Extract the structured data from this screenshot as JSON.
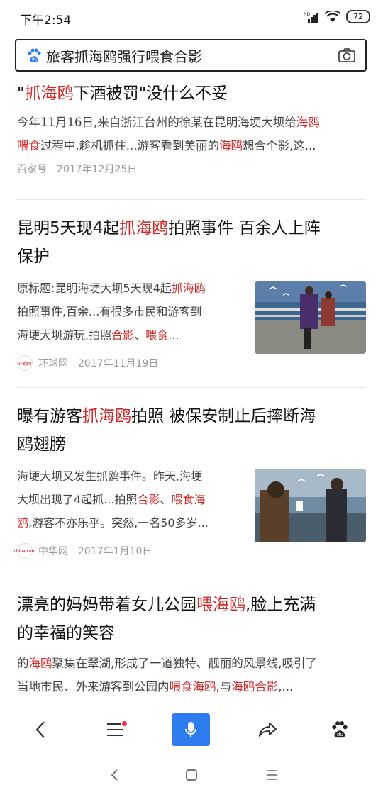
{
  "status": {
    "time": "下午2:54",
    "battery": "72"
  },
  "search": {
    "query": "旅客抓海鸥强行喂食合影"
  },
  "results": [
    {
      "title_parts": [
        "\"",
        "抓海鸥",
        "下酒被罚\"没什么不妥"
      ],
      "desc_line1": [
        "今年11月16日,来自浙江台州的徐某在昆明海埂大坝给",
        "海鸥"
      ],
      "desc_line2": [
        "喂食",
        "过程中,趁机抓住...游客看到美丽的",
        "海鸥",
        "想合个影,这..."
      ],
      "source": "百家号",
      "date": "2017年12月25日"
    },
    {
      "title_line1": [
        "昆明5天现4起",
        "抓海鸥",
        "拍照事件 百余人上阵"
      ],
      "title_line2": "保护",
      "desc_line1": [
        "原标题:昆明海埂大坝5天现4起",
        "抓海鸥"
      ],
      "desc_line2": "拍照事件,百余...有很多市民和游客到",
      "desc_line3": [
        "海埂大坝游玩,拍照",
        "合影",
        "、",
        "喂食",
        "..."
      ],
      "source_logo": "环球网",
      "source": "环球网",
      "date": "2017年11月19日"
    },
    {
      "title_line1": [
        "曝有游客",
        "抓海鸥",
        "拍照 被保安制止后摔断海"
      ],
      "title_line2": "鸥翅膀",
      "desc_line1": "海埂大坝又发生抓鸥事件。昨天,海埂",
      "desc_line2": [
        "大坝出现了4起抓...拍照",
        "合影",
        "、",
        "喂食海"
      ],
      "desc_line3": [
        "鸥",
        ",游客不亦乐乎。突然,一名50多岁..."
      ],
      "source_logo": "china.com",
      "source": "中华网",
      "date": "2017年1月10日"
    },
    {
      "title_line1": [
        "漂亮的妈妈带着女儿公园",
        "喂海鸥",
        ",脸上充满"
      ],
      "title_line2": "的幸福的笑容",
      "desc_line1": [
        "的",
        "海鸥",
        "聚集在翠湖,形成了一道独特、靓丽的风景线,吸引了"
      ],
      "desc_line2": [
        "当地市民、外来游客到公园内",
        "喂食海鸥",
        ",与",
        "海鸥合影",
        ",..."
      ]
    }
  ],
  "colors": {
    "highlight": "#d32a2a",
    "accent": "#2f7cf0"
  },
  "toolbar": [
    "back-icon",
    "menu-icon",
    "mic-icon",
    "share-icon",
    "paw-icon"
  ],
  "navbar": [
    "nav-back-icon",
    "nav-home-icon",
    "nav-recents-icon"
  ]
}
